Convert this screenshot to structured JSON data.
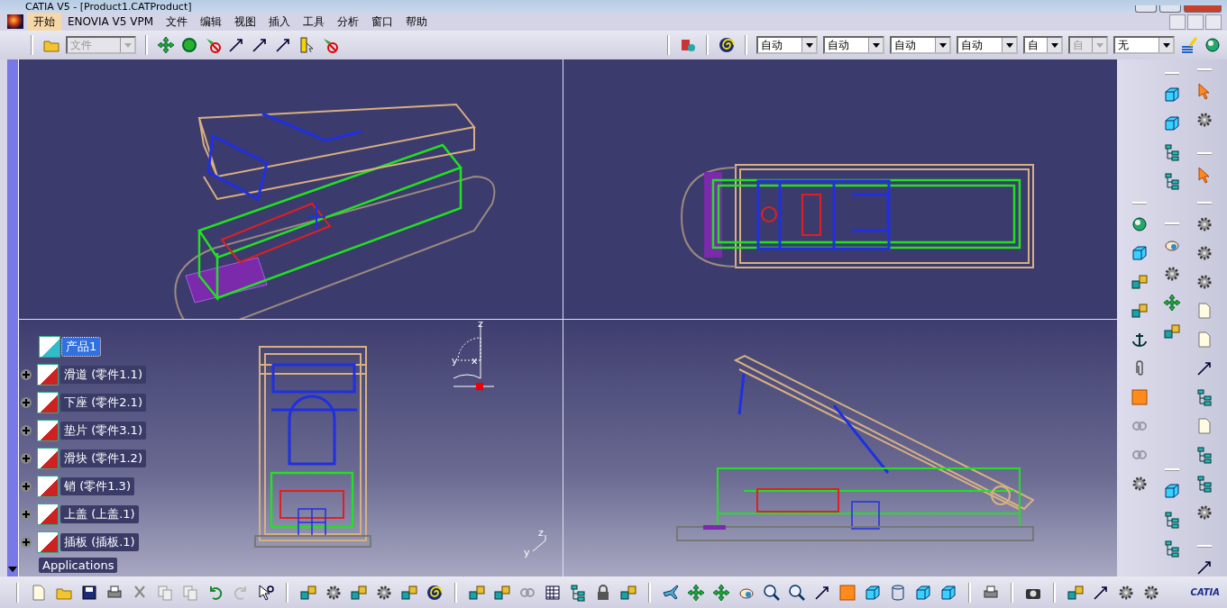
{
  "window": {
    "title": "CATIA V5 - [Product1.CATProduct]"
  },
  "menu_bar": [
    {
      "label": "开始",
      "selected": true
    },
    {
      "label": "ENOVIA V5 VPM",
      "selected": false
    },
    {
      "label": "文件",
      "selected": false
    },
    {
      "label": "编辑",
      "selected": false
    },
    {
      "label": "视图",
      "selected": false
    },
    {
      "label": "插入",
      "selected": false
    },
    {
      "label": "工具",
      "selected": false
    },
    {
      "label": "分析",
      "selected": false
    },
    {
      "label": "窗口",
      "selected": false
    },
    {
      "label": "帮助",
      "selected": false
    }
  ],
  "toolbar": {
    "file_combo": {
      "value": "文件",
      "disabled": true
    },
    "property_combos": [
      {
        "value": "自动",
        "disabled": false
      },
      {
        "value": "自动",
        "disabled": false
      },
      {
        "value": "自动",
        "disabled": false
      },
      {
        "value": "自动",
        "disabled": false
      },
      {
        "value": "自",
        "disabled": false
      },
      {
        "value": "自",
        "disabled": true
      },
      {
        "value": "无",
        "disabled": false
      }
    ]
  },
  "tree": {
    "root": {
      "label": "产品1",
      "selected": true
    },
    "children": [
      {
        "label": "滑道 (零件1.1)",
        "expanded": false
      },
      {
        "label": "下座 (零件2.1)",
        "expanded": false
      },
      {
        "label": "垫片 (零件3.1)",
        "expanded": false
      },
      {
        "label": "滑块 (零件1.2)",
        "expanded": false
      },
      {
        "label": "销 (零件1.3)",
        "expanded": false
      },
      {
        "label": "上盖 (上盖.1)",
        "expanded": false
      },
      {
        "label": "插板 (插板.1)",
        "expanded": false
      }
    ],
    "applications": "Applications"
  },
  "compass": {
    "z": "z",
    "y": "y",
    "x": "x"
  },
  "axis_triad": {
    "y": "y",
    "z": "z"
  },
  "logo": {
    "text": "CATIA"
  }
}
